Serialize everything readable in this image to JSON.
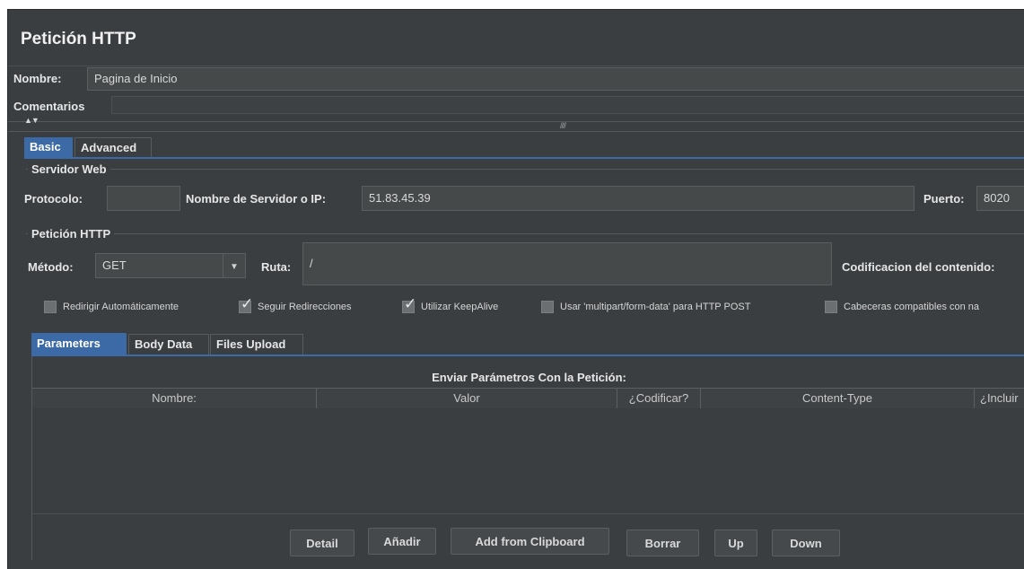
{
  "panel": {
    "title": "Petición HTTP",
    "name_label": "Nombre:",
    "name_value": "Pagina de Inicio",
    "comments_label": "Comentarios",
    "splitter_arrows": "▲▼",
    "splitter_grip": "////"
  },
  "tabs": [
    {
      "label": "Basic",
      "active": true
    },
    {
      "label": "Advanced",
      "active": false
    }
  ],
  "server": {
    "group_title": "Servidor Web",
    "protocol_label": "Protocolo:",
    "protocol_value": "",
    "host_label": "Nombre de Servidor o IP:",
    "host_value": "51.83.45.39",
    "port_label": "Puerto:",
    "port_value": "8020"
  },
  "request": {
    "group_title": "Petición HTTP",
    "method_label": "Método:",
    "method_value": "GET",
    "path_label": "Ruta:",
    "path_value": "/",
    "encoding_label": "Codificacion del contenido:"
  },
  "options": [
    {
      "label": "Redirigir Automáticamente",
      "checked": false
    },
    {
      "label": "Seguir Redirecciones",
      "checked": true
    },
    {
      "label": "Utilizar KeepAlive",
      "checked": true
    },
    {
      "label": "Usar 'multipart/form-data' para HTTP POST",
      "checked": false
    },
    {
      "label": "Cabeceras compatibles con na",
      "checked": false
    }
  ],
  "subtabs": [
    {
      "label": "Parameters",
      "active": true
    },
    {
      "label": "Body Data",
      "active": false
    },
    {
      "label": "Files Upload",
      "active": false
    }
  ],
  "params": {
    "caption": "Enviar Parámetros Con la Petición:",
    "columns": [
      "Nombre:",
      "Valor",
      "¿Codificar?",
      "Content-Type",
      "¿Incluir"
    ]
  },
  "buttons": {
    "detail": "Detail",
    "add": "Añadir",
    "add_clipboard": "Add from Clipboard",
    "delete": "Borrar",
    "up": "Up",
    "down": "Down"
  },
  "colors": {
    "background": "#3b3e41",
    "accent": "#3c6aa6",
    "field": "#45494a"
  }
}
